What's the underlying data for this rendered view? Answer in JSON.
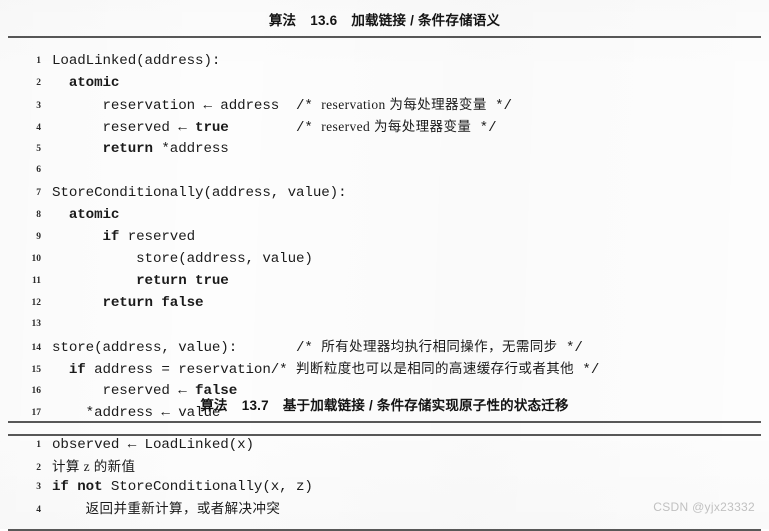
{
  "page": {
    "watermark": "CSDN @yjx23332",
    "background_color": "#fdfdfd",
    "rule_color": "#585858"
  },
  "algorithms": [
    {
      "id": "13.6",
      "title_prefix": "算法",
      "title_number": "13.6",
      "title_text": "加载链接 / 条件存储语义",
      "full_title": "算法 13.6　加载链接 / 条件存储语义",
      "lines": [
        {
          "no": "1",
          "indent": 0,
          "code": "LoadLinked(address):"
        },
        {
          "no": "2",
          "indent": 1,
          "code": "atomic",
          "bold": "atomic"
        },
        {
          "no": "3",
          "indent": 2,
          "code": "reservation ← address ",
          "comment_cjk": "/* reservation 为每处理器变量 */"
        },
        {
          "no": "4",
          "indent": 2,
          "code": "reserved ← true",
          "comment_cjk": "/* reserved 为每处理器变量 */"
        },
        {
          "no": "5",
          "indent": 2,
          "code": "return *address"
        },
        {
          "no": "6",
          "indent": 0,
          "code": ""
        },
        {
          "no": "7",
          "indent": 0,
          "code": "StoreConditionally(address, value):"
        },
        {
          "no": "8",
          "indent": 1,
          "code": "atomic"
        },
        {
          "no": "9",
          "indent": 2,
          "code": "if reserved"
        },
        {
          "no": "10",
          "indent": 3,
          "code": "store(address, value)"
        },
        {
          "no": "11",
          "indent": 3,
          "code": "return true"
        },
        {
          "no": "12",
          "indent": 2,
          "code": "return false"
        },
        {
          "no": "13",
          "indent": 0,
          "code": ""
        },
        {
          "no": "14",
          "indent": 0,
          "code": "store(address, value):",
          "comment_cjk": "/* 所有处理器均执行相同操作，无需同步 */"
        },
        {
          "no": "15",
          "indent": 1,
          "code": "if address = reservation",
          "comment_cjk": "/* 判断粒度也可以是相同的高速缓存行或者其他 */"
        },
        {
          "no": "16",
          "indent": 2,
          "code": "reserved ← false"
        },
        {
          "no": "17",
          "indent": 1,
          "code": "*address ← value"
        }
      ]
    },
    {
      "id": "13.7",
      "title_prefix": "算法",
      "title_number": "13.7",
      "title_text": "基于加载链接 / 条件存储实现原子性的状态迁移",
      "full_title": "算法 13.7　基于加载链接 / 条件存储实现原子性的状态迁移",
      "lines": [
        {
          "no": "1",
          "indent": 0,
          "code": "observed ← LoadLinked(x)"
        },
        {
          "no": "2",
          "indent": 0,
          "code": "计算 z 的新值"
        },
        {
          "no": "3",
          "indent": 0,
          "code": "if not StoreConditionally(x, z)"
        },
        {
          "no": "4",
          "indent": 1,
          "code": "返回并重新计算，或者解决冲突"
        }
      ]
    }
  ]
}
